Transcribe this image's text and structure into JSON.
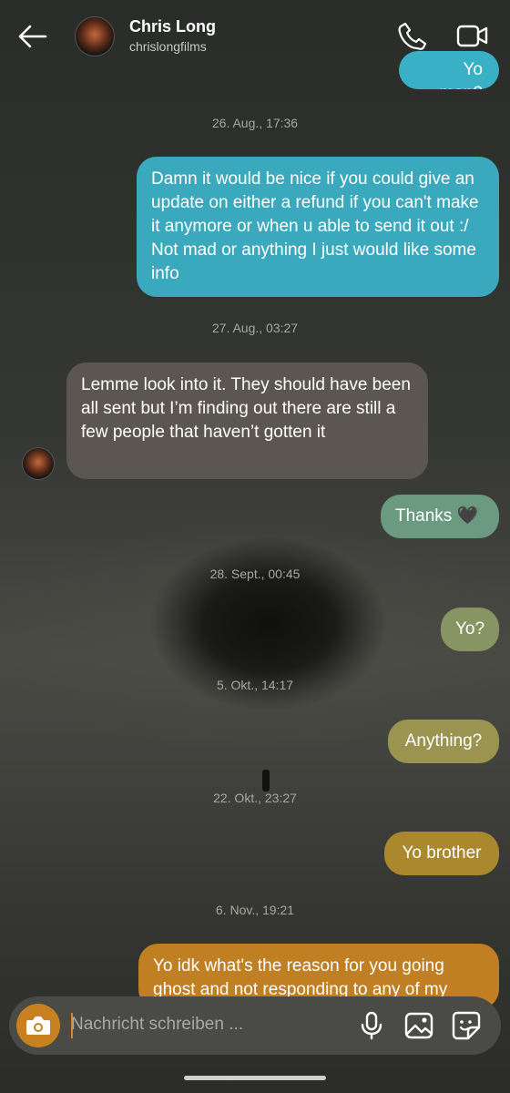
{
  "header": {
    "name": "Chris Long",
    "handle": "chrislongfilms"
  },
  "composer": {
    "placeholder": "Nachricht schreiben ..."
  },
  "messages": [
    {
      "type": "out",
      "text": "Yo man?",
      "color": "#39b0c6"
    },
    {
      "type": "time",
      "text": "26. Aug., 17:36"
    },
    {
      "type": "out",
      "text": "Damn it would be nice if you could give an update on either a refund if you can't make it anymore or when u able to send it out :/ Not mad or anything I just would like some info",
      "color": "#3aa8bd"
    },
    {
      "type": "time",
      "text": "27. Aug., 03:27"
    },
    {
      "type": "in",
      "text": "Lemme look into it. They should have been all sent but I’m finding out there are still a few people that haven’t gotten it",
      "color": "#5b564f"
    },
    {
      "type": "out",
      "text": "Thanks 🖤",
      "color": "#6b9a80"
    },
    {
      "type": "time",
      "text": "28. Sept., 00:45"
    },
    {
      "type": "out",
      "text": "Yo?",
      "color": "#869563"
    },
    {
      "type": "time",
      "text": "5. Okt., 14:17"
    },
    {
      "type": "out",
      "text": "Anything?",
      "color": "#9a9450"
    },
    {
      "type": "time",
      "text": "22. Okt., 23:27"
    },
    {
      "type": "out",
      "text": "Yo brother",
      "color": "#a9882e"
    },
    {
      "type": "time",
      "text": "6. Nov., 19:21"
    },
    {
      "type": "out",
      "text": "Yo idk what's the reason for you going ghost and not responding to any of my",
      "color": "#c07f22"
    }
  ],
  "icons": {
    "back": "arrow-left-icon",
    "call": "phone-icon",
    "video": "video-camera-icon",
    "camera": "camera-icon",
    "mic": "microphone-icon",
    "gallery": "image-icon",
    "sticker": "sticker-icon"
  }
}
